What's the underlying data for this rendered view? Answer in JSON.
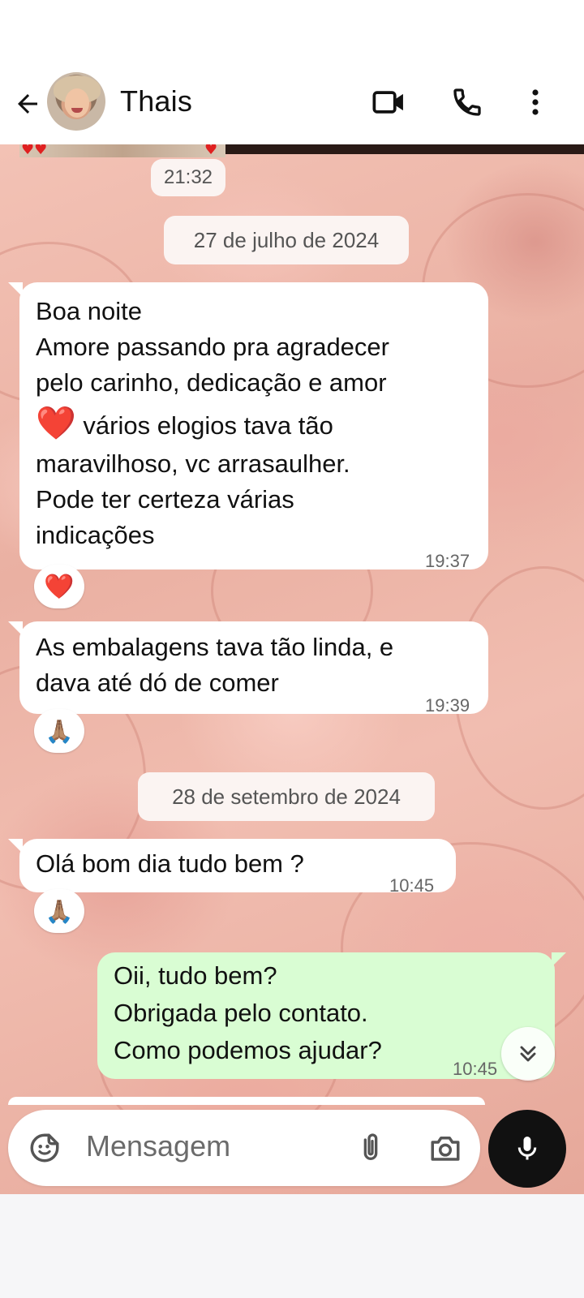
{
  "header": {
    "contact_name": "Thais",
    "icons": [
      "back-arrow-icon",
      "video-call-icon",
      "phone-call-icon",
      "more-options-icon"
    ]
  },
  "chat": {
    "top_time": "21:32",
    "dates": [
      "27 de julho de 2024",
      "28 de setembro de 2024"
    ],
    "messages": [
      {
        "direction": "incoming",
        "line1": "Boa noite",
        "line2": "Amore passando pra agradecer",
        "line3": "pelo carinho, dedicação e amor",
        "line4_emoji": "❤️",
        "line4": " vários elogios tava tão",
        "line5": "maravilhoso, vc arrasaulher.",
        "line6": "Pode ter certeza várias",
        "line7": "indicações",
        "time": "19:37",
        "reaction": "❤️"
      },
      {
        "direction": "incoming",
        "text": "As embalagens tava tão linda, e\ndava até dó de comer",
        "time": "19:39",
        "reaction": "🙏🏽"
      },
      {
        "direction": "incoming",
        "text": "Olá bom dia tudo bem ?",
        "time": "10:45",
        "reaction": "🙏🏽"
      },
      {
        "direction": "outgoing",
        "text": "Oii, tudo bem?\nObrigada pelo contato.\nComo podemos ajudar?",
        "time": "10:45"
      }
    ]
  },
  "composer": {
    "placeholder": "Mensagem",
    "icons": [
      "sticker-icon",
      "attach-icon",
      "camera-icon",
      "microphone-icon"
    ]
  },
  "colors": {
    "incoming_bubble": "#ffffff",
    "outgoing_bubble": "#d9fdd3",
    "mic_button": "#111111"
  }
}
